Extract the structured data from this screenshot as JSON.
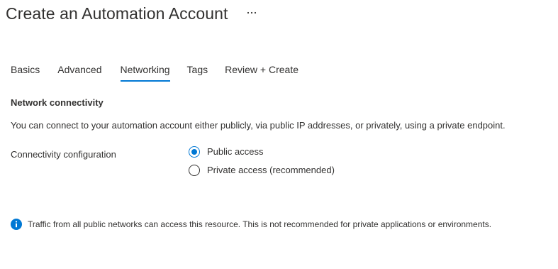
{
  "header": {
    "title": "Create an Automation Account",
    "more_icon": "ellipsis-icon"
  },
  "tabs": [
    {
      "label": "Basics",
      "active": false
    },
    {
      "label": "Advanced",
      "active": false
    },
    {
      "label": "Networking",
      "active": true
    },
    {
      "label": "Tags",
      "active": false
    },
    {
      "label": "Review + Create",
      "active": false
    }
  ],
  "network": {
    "section_title": "Network connectivity",
    "description": "You can connect to your automation account either publicly, via public IP addresses, or privately, using a private endpoint.",
    "field_label": "Connectivity configuration",
    "options": [
      {
        "label": "Public access",
        "selected": true
      },
      {
        "label": "Private access (recommended)",
        "selected": false
      }
    ]
  },
  "info": {
    "icon": "info-icon",
    "text": "Traffic from all public networks can access this resource. This is not recommended for private applications or environments."
  },
  "colors": {
    "accent": "#0078d4",
    "text": "#323130"
  }
}
